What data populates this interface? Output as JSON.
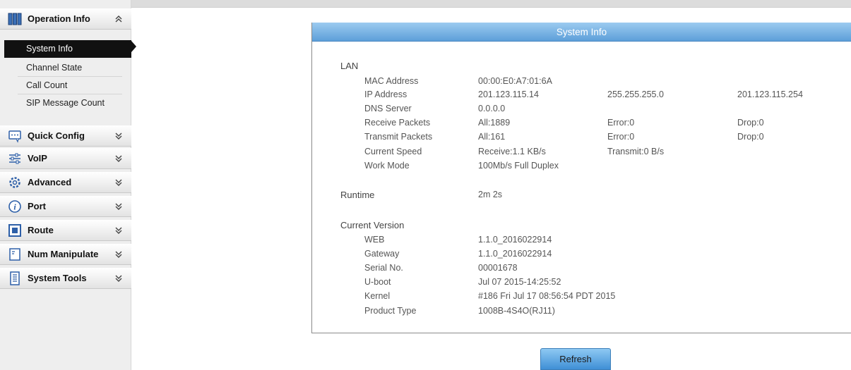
{
  "sidebar": {
    "operation": {
      "label": "Operation Info"
    },
    "submenu": [
      "System Info",
      "Channel State",
      "Call Count",
      "SIP Message Count"
    ],
    "sections": [
      {
        "label": "Quick Config",
        "icon": "quick-config-icon"
      },
      {
        "label": "VoIP",
        "icon": "voip-icon"
      },
      {
        "label": "Advanced",
        "icon": "gear-icon"
      },
      {
        "label": "Port",
        "icon": "info-icon"
      },
      {
        "label": "Route",
        "icon": "route-icon"
      },
      {
        "label": "Num Manipulate",
        "icon": "num-manipulate-icon"
      },
      {
        "label": "System Tools",
        "icon": "system-tools-icon"
      }
    ]
  },
  "panel": {
    "title": "System Info",
    "lan": {
      "title": "LAN",
      "mac": {
        "label": "MAC Address",
        "value": "00:00:E0:A7:01:6A"
      },
      "ip": {
        "label": "IP Address",
        "value": "201.123.115.14",
        "mask": "255.255.255.0",
        "gateway": "201.123.115.254"
      },
      "dns": {
        "label": "DNS Server",
        "value": "0.0.0.0"
      },
      "rx": {
        "label": "Receive Packets",
        "all": "All:1889",
        "error": "Error:0",
        "drop": "Drop:0"
      },
      "tx": {
        "label": "Transmit Packets",
        "all": "All:161",
        "error": "Error:0",
        "drop": "Drop:0"
      },
      "speed": {
        "label": "Current Speed",
        "receive": "Receive:1.1 KB/s",
        "transmit": "Transmit:0 B/s"
      },
      "mode": {
        "label": "Work Mode",
        "value": "100Mb/s Full Duplex"
      }
    },
    "runtime": {
      "label": "Runtime",
      "value": "2m 2s"
    },
    "version": {
      "title": "Current Version",
      "web": {
        "label": "WEB",
        "value": "1.1.0_2016022914"
      },
      "gateway": {
        "label": "Gateway",
        "value": "1.1.0_2016022914"
      },
      "serial": {
        "label": "Serial No.",
        "value": "00001678"
      },
      "uboot": {
        "label": "U-boot",
        "value": "Jul 07 2015-14:25:52"
      },
      "kernel": {
        "label": "Kernel",
        "value": "#186 Fri Jul 17 08:56:54 PDT 2015"
      },
      "product": {
        "label": "Product Type",
        "value": "1008B-4S4O(RJ11)"
      }
    }
  },
  "buttons": {
    "refresh": "Refresh"
  },
  "colors": {
    "header_blue": "#5d9fd9",
    "active_item": "#111111",
    "text_gray": "#555555"
  }
}
